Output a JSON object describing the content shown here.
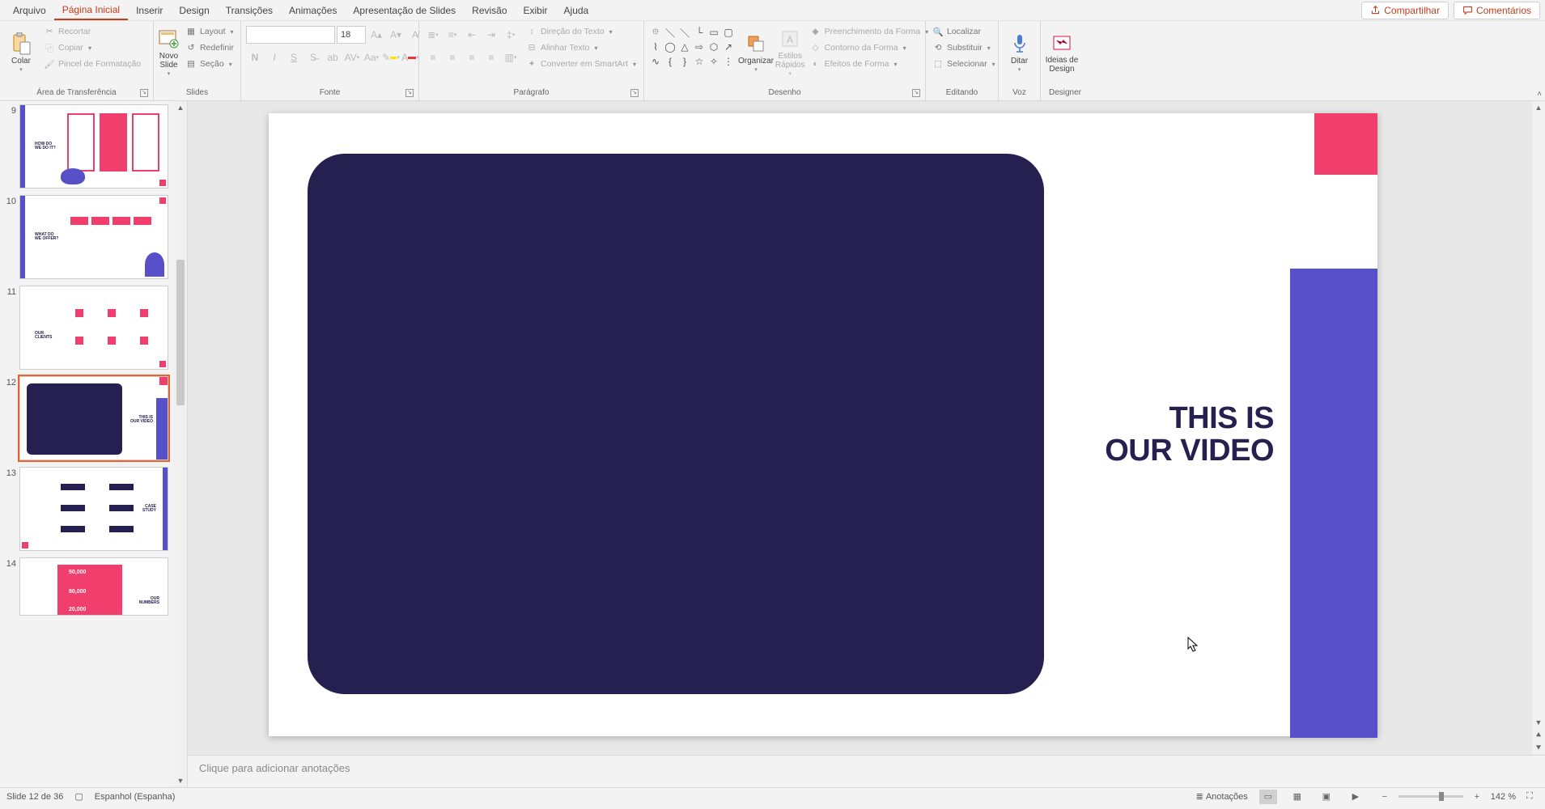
{
  "menu": {
    "tabs": [
      "Arquivo",
      "Página Inicial",
      "Inserir",
      "Design",
      "Transições",
      "Animações",
      "Apresentação de Slides",
      "Revisão",
      "Exibir",
      "Ajuda"
    ],
    "active_index": 1,
    "share": "Compartilhar",
    "comments": "Comentários"
  },
  "ribbon": {
    "clipboard": {
      "label": "Área de Transferência",
      "paste": "Colar",
      "cut": "Recortar",
      "copy": "Copiar",
      "format_painter": "Pincel de Formatação"
    },
    "slides": {
      "label": "Slides",
      "new_slide": "Novo Slide",
      "layout": "Layout",
      "reset": "Redefinir",
      "section": "Seção"
    },
    "font": {
      "label": "Fonte",
      "size": "18"
    },
    "paragraph": {
      "label": "Parágrafo",
      "text_direction": "Direção do Texto",
      "align_text": "Alinhar Texto",
      "smartart": "Converter em SmartArt"
    },
    "drawing": {
      "label": "Desenho",
      "arrange": "Organizar",
      "quick_styles": "Estilos Rápidos",
      "shape_fill": "Preenchimento da Forma",
      "shape_outline": "Contorno da Forma",
      "shape_effects": "Efeitos de Forma"
    },
    "editing": {
      "label": "Editando",
      "find": "Localizar",
      "replace": "Substituir",
      "select": "Selecionar"
    },
    "voice": {
      "label": "Voz",
      "dictate": "Ditar"
    },
    "designer": {
      "label": "Designer",
      "ideas": "Ideias de Design"
    }
  },
  "thumbs": {
    "numbers": [
      "9",
      "10",
      "11",
      "12",
      "13",
      "14"
    ],
    "selected": "12"
  },
  "slide": {
    "title_line1": "THIS IS",
    "title_line2": "OUR VIDEO"
  },
  "notes": {
    "placeholder": "Clique para adicionar anotações"
  },
  "status": {
    "slide_counter": "Slide 12 de 36",
    "language": "Espanhol (Espanha)",
    "notes_btn": "Anotações",
    "zoom": "142 %"
  },
  "colors": {
    "accent": "#c43e1c",
    "navy": "#252050",
    "purple": "#5850c8",
    "pink": "#f03e6d"
  }
}
